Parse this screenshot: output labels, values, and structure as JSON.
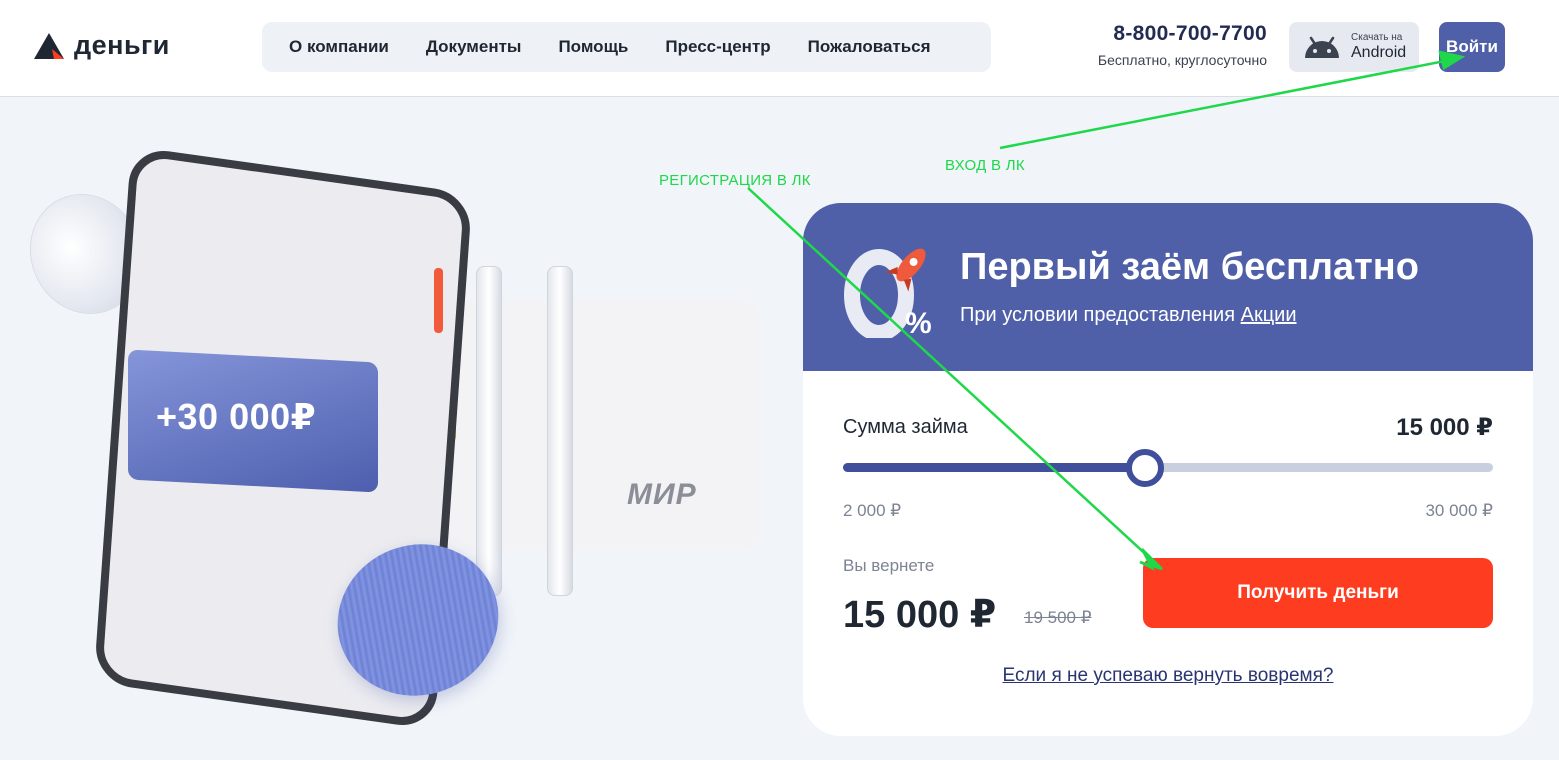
{
  "header": {
    "logo_text": "деньги",
    "nav": [
      "О компании",
      "Документы",
      "Помощь",
      "Пресс-центр",
      "Пожаловаться"
    ],
    "phone": "8-800-700-7700",
    "phone_sub": "Бесплатно, круглосуточно",
    "android_small": "Скачать на",
    "android_big": "Android",
    "login": "Войти"
  },
  "hero": {
    "plus_amount": "+30 000₽",
    "card_brand": "МИР"
  },
  "annotations": {
    "registration": "РЕГИСТРАЦИЯ В ЛК",
    "login": "ВХОД В ЛК"
  },
  "promo": {
    "badge_zero": "0",
    "badge_percent": "%",
    "title": "Первый заём бесплатно",
    "subtitle": "При условии предоставления",
    "subtitle_link": "Акции"
  },
  "loan": {
    "sum_label": "Сумма займа",
    "sum_value": "15 000 ₽",
    "slider_min": 2000,
    "slider_max": 30000,
    "slider_value": 15000,
    "min_label": "2 000 ₽",
    "max_label": "30 000 ₽",
    "return_label": "Вы вернете",
    "return_value": "15 000 ₽",
    "return_old": "19 500 ₽",
    "cta": "Получить деньги",
    "late_link": "Если я не успеваю вернуть вовремя?"
  },
  "colors": {
    "accent": "#4f60a8",
    "cta": "#fe3d20",
    "annotation": "#1ed84a"
  }
}
